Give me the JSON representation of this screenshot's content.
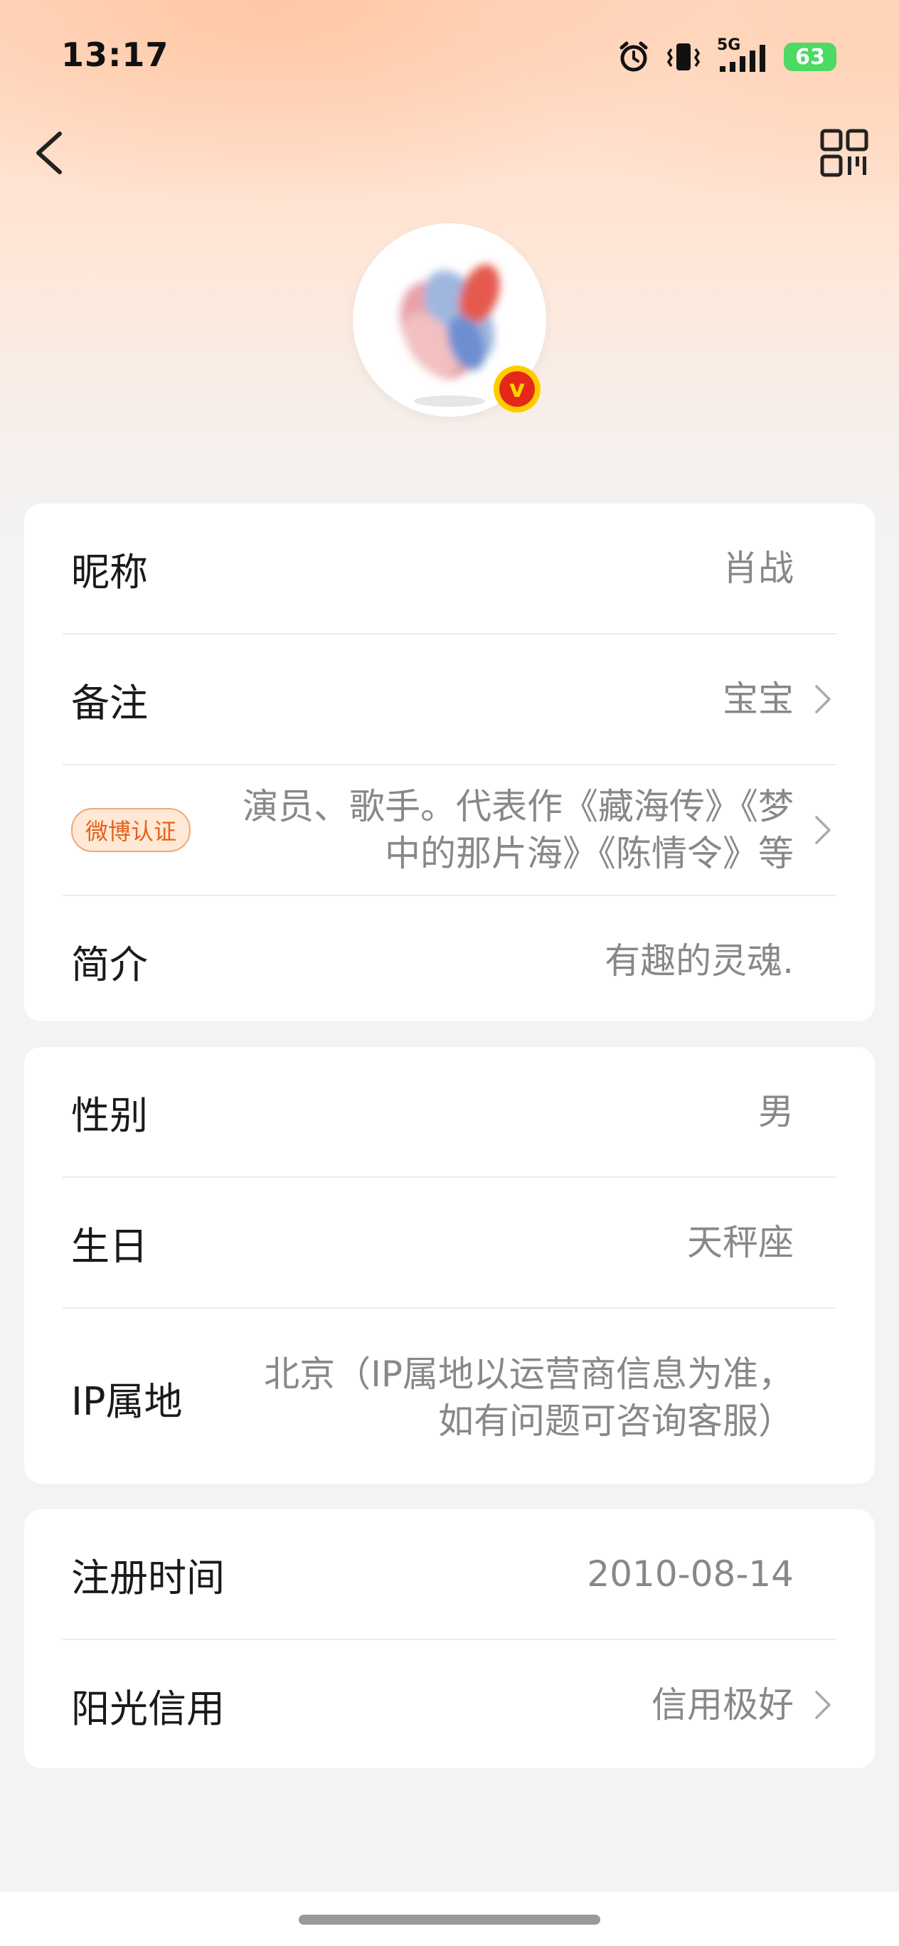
{
  "status_bar": {
    "time": "13:17",
    "network": "5G",
    "battery": "63"
  },
  "profile": {
    "verified": true
  },
  "card1": {
    "nickname": {
      "label": "昵称",
      "value": "肖战"
    },
    "remark": {
      "label": "备注",
      "value": "宝宝"
    },
    "verification": {
      "badge": "微博认证",
      "line1": "演员、歌手。代表作《藏海传》《梦",
      "line2": "中的那片海》《陈情令》等"
    },
    "bio": {
      "label": "简介",
      "value": "有趣的灵魂."
    }
  },
  "card2": {
    "gender": {
      "label": "性别",
      "value": "男"
    },
    "birthday": {
      "label": "生日",
      "value": "天秤座"
    },
    "ip": {
      "label": "IP属地",
      "line1": "北京（IP属地以运营商信息为准，",
      "line2": "如有问题可咨询客服）"
    }
  },
  "card3": {
    "register": {
      "label": "注册时间",
      "value": "2010-08-14"
    },
    "credit": {
      "label": "阳光信用",
      "value": "信用极好"
    }
  },
  "colors": {
    "accent": "#e8601a",
    "battery": "#4cd964",
    "vbadge": "#e5281a"
  }
}
